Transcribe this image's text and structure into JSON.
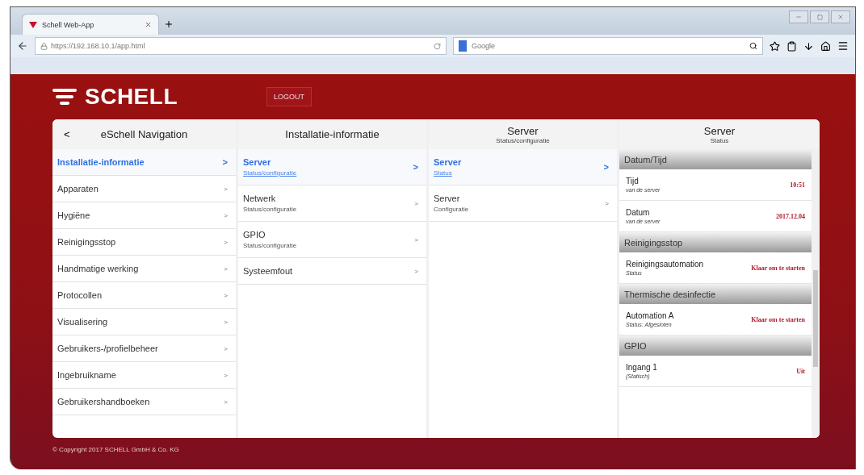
{
  "browser": {
    "tab_title": "Schell Web-App",
    "url": "https://192.168.10.1/app.html",
    "search": {
      "placeholder": "Google"
    }
  },
  "header": {
    "logo": "SCHELL",
    "logout": "LOGOUT"
  },
  "navigation": {
    "back": "<",
    "title": "eSchell Navigation",
    "items": [
      {
        "label": "Installatie-informatie",
        "selected": true,
        "arrow": ">"
      },
      {
        "label": "Apparaten",
        "selected": false,
        "arrow": ">"
      },
      {
        "label": "Hygiëne",
        "selected": false,
        "arrow": ">"
      },
      {
        "label": "Reinigingsstop",
        "selected": false,
        "arrow": ">"
      },
      {
        "label": "Handmatige werking",
        "selected": false,
        "arrow": ">"
      },
      {
        "label": "Protocollen",
        "selected": false,
        "arrow": ">"
      },
      {
        "label": "Visualisering",
        "selected": false,
        "arrow": ">"
      },
      {
        "label": "Gebruikers-/profielbeheer",
        "selected": false,
        "arrow": ">"
      },
      {
        "label": "Ingebruikname",
        "selected": false,
        "arrow": ">"
      },
      {
        "label": "Gebruikershandboeken",
        "selected": false,
        "arrow": ">"
      }
    ]
  },
  "installation": {
    "title": "Installatie-informatie",
    "items": [
      {
        "label": "Server",
        "sub": "Status/configuratie",
        "selected": true,
        "arrow": ">"
      },
      {
        "label": "Netwerk",
        "sub": "Status/configuratie",
        "selected": false,
        "arrow": ">"
      },
      {
        "label": "GPIO",
        "sub": "Status/configuratie",
        "selected": false,
        "arrow": ">"
      },
      {
        "label": "Systeemfout",
        "selected": false,
        "arrow": ">"
      }
    ]
  },
  "server": {
    "title": "Server",
    "subtitle": "Status/configuratie",
    "items": [
      {
        "label": "Server",
        "sub": "Status",
        "selected": true,
        "arrow": ">"
      },
      {
        "label": "Server",
        "sub": "Configuratie",
        "selected": false,
        "arrow": ">"
      }
    ]
  },
  "status": {
    "title": "Server",
    "subtitle": "Status",
    "sections": [
      {
        "heading": "Datum/Tijd",
        "rows": [
          {
            "label": "Tijd",
            "sub": "van de server",
            "value": "10:51"
          },
          {
            "label": "Datum",
            "sub": "van de server",
            "value": "2017.12.04"
          }
        ]
      },
      {
        "heading": "Reinigingsstop",
        "rows": [
          {
            "label": "Reinigingsautomation",
            "sub": "Status",
            "value": "Klaar om te starten"
          }
        ]
      },
      {
        "heading": "Thermische desinfectie",
        "rows": [
          {
            "label": "Automation A",
            "sub": "Status: Afgesloten",
            "value": "Klaar om te starten"
          }
        ]
      },
      {
        "heading": "GPIO",
        "rows": [
          {
            "label": "Ingang 1",
            "sub": "(Statisch)",
            "value": "Uit"
          }
        ]
      }
    ]
  },
  "footer": {
    "copyright": "© Copyright 2017 SCHELL GmbH & Co. KG"
  }
}
